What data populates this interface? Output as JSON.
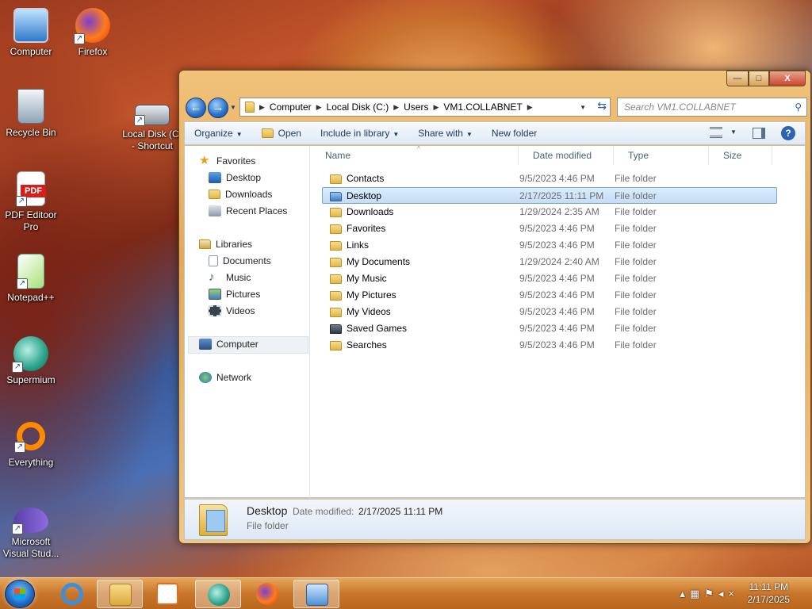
{
  "desktop": {
    "icons": [
      {
        "label": "Computer"
      },
      {
        "label": "Firefox"
      },
      {
        "label": "Recycle Bin"
      },
      {
        "label": "Local Disk (C) - Shortcut"
      },
      {
        "label": "PDF Editoor Pro"
      },
      {
        "label": "Notepad++"
      },
      {
        "label": "Supermium"
      },
      {
        "label": "Everything"
      },
      {
        "label": "Microsoft Visual Stud..."
      }
    ]
  },
  "window": {
    "controls": {
      "minimize": "—",
      "maximize": "□",
      "close": "X"
    },
    "address": {
      "segments": [
        "Computer",
        "Local Disk (C:)",
        "Users",
        "VM1.COLLABNET"
      ]
    },
    "search": {
      "placeholder": "Search VM1.COLLABNET"
    },
    "toolbar": {
      "organize": "Organize",
      "open": "Open",
      "include_in_library": "Include in library",
      "share_with": "Share with",
      "new_folder": "New folder"
    },
    "nav_pane": {
      "favorites": "Favorites",
      "desktop": "Desktop",
      "downloads": "Downloads",
      "recent_places": "Recent Places",
      "libraries": "Libraries",
      "documents": "Documents",
      "music": "Music",
      "pictures": "Pictures",
      "videos": "Videos",
      "computer": "Computer",
      "network": "Network"
    },
    "columns": {
      "name": "Name",
      "date_modified": "Date modified",
      "type": "Type",
      "size": "Size"
    },
    "files": [
      {
        "name": "Contacts",
        "date": "9/5/2023 4:46 PM",
        "type": "File folder"
      },
      {
        "name": "Desktop",
        "date": "2/17/2025 11:11 PM",
        "type": "File folder",
        "selected": true
      },
      {
        "name": "Downloads",
        "date": "1/29/2024 2:35 AM",
        "type": "File folder"
      },
      {
        "name": "Favorites",
        "date": "9/5/2023 4:46 PM",
        "type": "File folder"
      },
      {
        "name": "Links",
        "date": "9/5/2023 4:46 PM",
        "type": "File folder"
      },
      {
        "name": "My Documents",
        "date": "1/29/2024 2:40 AM",
        "type": "File folder"
      },
      {
        "name": "My Music",
        "date": "9/5/2023 4:46 PM",
        "type": "File folder"
      },
      {
        "name": "My Pictures",
        "date": "9/5/2023 4:46 PM",
        "type": "File folder"
      },
      {
        "name": "My Videos",
        "date": "9/5/2023 4:46 PM",
        "type": "File folder"
      },
      {
        "name": "Saved Games",
        "date": "9/5/2023 4:46 PM",
        "type": "File folder"
      },
      {
        "name": "Searches",
        "date": "9/5/2023 4:46 PM",
        "type": "File folder"
      }
    ],
    "details": {
      "name": "Desktop",
      "date_label": "Date modified:",
      "date_value": "2/17/2025 11:11 PM",
      "type": "File folder"
    }
  },
  "taskbar": {
    "apps": [
      "internet-explorer-icon",
      "windows-explorer-icon",
      "media-player-icon",
      "supermium-icon",
      "firefox-icon",
      "remote-desktop-icon"
    ],
    "clock": {
      "time": "11:11 PM",
      "date": "2/17/2025"
    }
  }
}
